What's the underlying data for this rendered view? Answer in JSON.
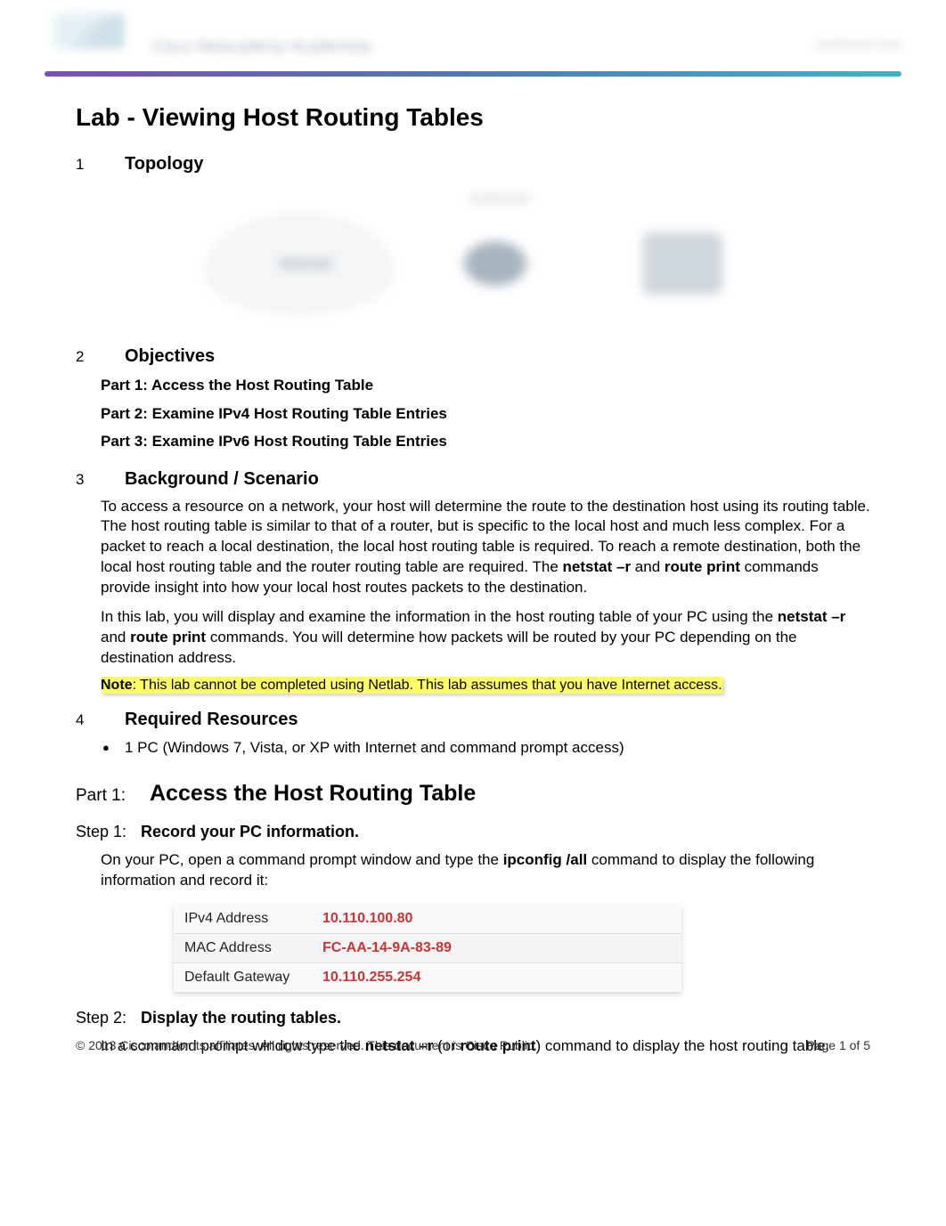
{
  "header": {
    "tagline": "Cisco Netacademy Academicly",
    "right": "XXXXXXX XXX"
  },
  "title": "Lab - Viewing Host Routing Tables",
  "sections": {
    "topology": {
      "num": "1",
      "title": "Topology"
    },
    "objectives": {
      "num": "2",
      "title": "Objectives",
      "items": [
        "Part 1: Access the Host Routing Table",
        "Part 2: Examine IPv4 Host Routing Table Entries",
        "Part 3: Examine IPv6 Host Routing Table Entries"
      ]
    },
    "background": {
      "num": "3",
      "title": "Background / Scenario",
      "para1_a": "To access a resource on a network, your host will determine the route to the destination host using its routing table. The host routing table is similar to that of a router, but is specific to the local host and much less complex. For a packet to reach a local destination, the local host routing table is required. To reach a remote destination, both the local host routing table and the router routing table are required. The ",
      "para1_b": "netstat –r",
      "para1_c": " and ",
      "para1_d": "route print",
      "para1_e": " commands provide insight into how your local host routes packets to the destination.",
      "para2_a": "In this lab, you will display and examine the information in the host routing table of your PC using the ",
      "para2_b": "netstat –r",
      "para2_c": " and ",
      "para2_d": "route print",
      "para2_e": " commands. You will determine how packets will be routed by your PC depending on the destination address.",
      "note_label": "Note",
      "note_text": ": This lab cannot be completed using Netlab. This lab assumes that you have Internet access."
    },
    "resources": {
      "num": "4",
      "title": "Required Resources",
      "bullet": "1 PC (Windows 7, Vista, or XP with Internet and command prompt access)"
    }
  },
  "part1": {
    "num": "Part 1:",
    "title": "Access the Host Routing Table",
    "step1": {
      "num": "Step 1:",
      "title": "Record your PC information.",
      "text_a": "On your PC, open a command prompt window and type the ",
      "text_b": "ipconfig /all",
      "text_c": " command to display the following information and record it:",
      "table": [
        {
          "label": "IPv4 Address",
          "value": "10.110.100.80"
        },
        {
          "label": "MAC Address",
          "value": "FC-AA-14-9A-83-89"
        },
        {
          "label": "Default Gateway",
          "value": "10.110.255.254"
        }
      ]
    },
    "step2": {
      "num": "Step 2:",
      "title": "Display the routing tables.",
      "text_a": "In a command prompt window type the ",
      "text_b": "netstat –r",
      "text_c": " (or ",
      "text_d": "route print",
      "text_e": ") command to display the host routing table."
    }
  },
  "topology_diagram": {
    "cloud": "Internet",
    "router_label": "Small Router"
  },
  "footer": {
    "copyright": "© 2013 Cisco and/or its affiliates. All rights reserved. This document is Cisco Public.",
    "page": "Page 1 of 5"
  }
}
